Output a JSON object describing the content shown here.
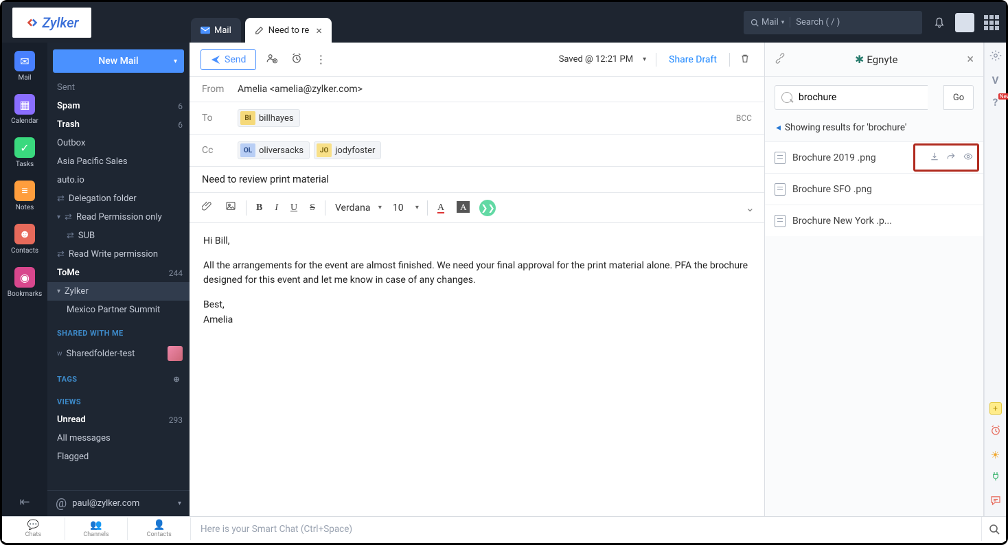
{
  "brand": {
    "name": "Zylker"
  },
  "header": {
    "tab_mail": "Mail",
    "tab_compose": "Need to re",
    "search_scope": "Mail",
    "search_placeholder": "Search ( / )"
  },
  "rail": {
    "mail": "Mail",
    "calendar": "Calendar",
    "tasks": "Tasks",
    "notes": "Notes",
    "contacts": "Contacts",
    "bookmarks": "Bookmarks"
  },
  "newmail": "New Mail",
  "folders": {
    "sent": "Sent",
    "spam": {
      "name": "Spam",
      "count": "6"
    },
    "trash": {
      "name": "Trash",
      "count": "6"
    },
    "outbox": "Outbox",
    "aps": "Asia Pacific Sales",
    "auto": "auto.io",
    "deleg": "Delegation folder",
    "readperm": "Read Permission only",
    "sub": "SUB",
    "rwperm": "Read Write permission",
    "tome": {
      "name": "ToMe",
      "count": "244"
    },
    "zylker": "Zylker",
    "mexico": "Mexico Partner Summit"
  },
  "sections": {
    "shared": "SHARED WITH ME",
    "tags": "TAGS",
    "views": "VIEWS"
  },
  "shared_item": "Sharedfolder-test",
  "views": {
    "unread": {
      "name": "Unread",
      "count": "293"
    },
    "allmsg": "All messages",
    "flagged": "Flagged"
  },
  "user_email": "paul@zylker.com",
  "compose": {
    "send": "Send",
    "saved": "Saved @ 12:21 PM",
    "share_draft": "Share Draft",
    "from_label": "From",
    "from_value": "Amelia <amelia@zylker.com>",
    "to_label": "To",
    "cc_label": "Cc",
    "bcc": "BCC",
    "chips": {
      "bi": {
        "badge": "BI",
        "name": "billhayes"
      },
      "ol": {
        "badge": "OL",
        "name": "oliversacks"
      },
      "jo": {
        "badge": "JO",
        "name": "jodyfoster"
      }
    },
    "subject": "Need to review print material",
    "font": "Verdana",
    "size": "10",
    "body": {
      "l1": "Hi Bill,",
      "l2": "All the arrangements for the event are almost finished. We need your final approval for the print material alone. PFA the brochure designed for this event and let me know in case of any changes.",
      "l3": "Best,",
      "l4": "Amelia"
    }
  },
  "egnyte": {
    "title": "Egnyte",
    "query": "brochure",
    "go": "Go",
    "results_header": "Showing results for 'brochure'",
    "r1": "Brochure 2019 .png",
    "r2": "Brochure SFO .png",
    "r3": "Brochure New York .p..."
  },
  "bottom": {
    "chats": "Chats",
    "channels": "Channels",
    "contacts": "Contacts",
    "smartchat": "Here is your Smart Chat (Ctrl+Space)"
  },
  "far_rail": {
    "new": "New"
  }
}
